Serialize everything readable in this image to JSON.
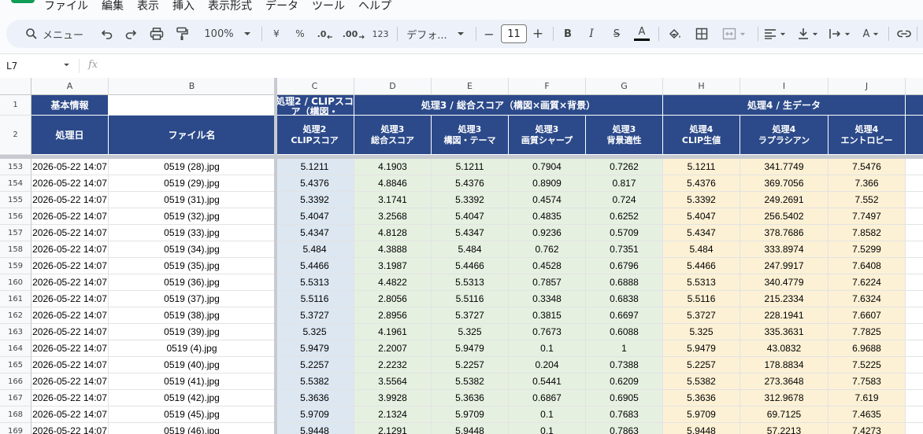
{
  "menu": [
    "ファイル",
    "編集",
    "表示",
    "挿入",
    "表示形式",
    "データ",
    "ツール",
    "ヘルプ"
  ],
  "toolbar": {
    "search_label": "メニュー",
    "zoom": "100%",
    "currency": "¥",
    "percent": "%",
    "dec_decrease": ".0",
    "dec_increase": ".00",
    "number_format": "123",
    "font": "デフォ...",
    "font_size": "11",
    "minus": "−",
    "plus": "+",
    "bold": "B",
    "italic": "I",
    "strike": "S",
    "text_color": "A"
  },
  "formula_bar": {
    "name_box": "L7",
    "fx": "fx"
  },
  "columns": [
    "A",
    "B",
    "C",
    "D",
    "E",
    "F",
    "G",
    "H",
    "I",
    "J"
  ],
  "header_row1": {
    "row_no": "1",
    "a": "基本情報",
    "c": "処理2 / CLIPスコア（構図・",
    "defg": "処理3 / 総合スコア（構図×画質×背景）",
    "hij": "処理4 / 生データ"
  },
  "header_row2": {
    "row_no": "2",
    "cells": [
      [
        "処理日"
      ],
      [
        "ファイル名"
      ],
      [
        "処理2",
        "CLIPスコア"
      ],
      [
        "処理3",
        "総合スコア"
      ],
      [
        "処理3",
        "構図・テーマ"
      ],
      [
        "処理3",
        "画質シャープ"
      ],
      [
        "処理3",
        "背景適性"
      ],
      [
        "処理4",
        "CLIP生値"
      ],
      [
        "処理4",
        "ラプラシアン"
      ],
      [
        "処理4",
        "エントロピー"
      ]
    ]
  },
  "colors": {
    "header_blue": "#2c4a8a",
    "col_c": "#dde7f1",
    "col_defg": "#e6f0e1",
    "col_hij": "#fdf1d5"
  },
  "rows": [
    {
      "n": "153",
      "date": "2026-05-22 14:07",
      "file": "0519 (28).jpg",
      "c": "5.1211",
      "d": "4.1903",
      "e": "5.1211",
      "f": "0.7904",
      "g": "0.7262",
      "h": "5.1211",
      "i": "341.7749",
      "j": "7.5476"
    },
    {
      "n": "154",
      "date": "2026-05-22 14:07",
      "file": "0519 (29).jpg",
      "c": "5.4376",
      "d": "4.8846",
      "e": "5.4376",
      "f": "0.8909",
      "g": "0.817",
      "h": "5.4376",
      "i": "369.7056",
      "j": "7.366"
    },
    {
      "n": "155",
      "date": "2026-05-22 14:07",
      "file": "0519 (31).jpg",
      "c": "5.3392",
      "d": "3.1741",
      "e": "5.3392",
      "f": "0.4574",
      "g": "0.724",
      "h": "5.3392",
      "i": "249.2691",
      "j": "7.552"
    },
    {
      "n": "156",
      "date": "2026-05-22 14:07",
      "file": "0519 (32).jpg",
      "c": "5.4047",
      "d": "3.2568",
      "e": "5.4047",
      "f": "0.4835",
      "g": "0.6252",
      "h": "5.4047",
      "i": "256.5402",
      "j": "7.7497"
    },
    {
      "n": "157",
      "date": "2026-05-22 14:07",
      "file": "0519 (33).jpg",
      "c": "5.4347",
      "d": "4.8128",
      "e": "5.4347",
      "f": "0.9236",
      "g": "0.5709",
      "h": "5.4347",
      "i": "378.7686",
      "j": "7.8582"
    },
    {
      "n": "158",
      "date": "2026-05-22 14:07",
      "file": "0519 (34).jpg",
      "c": "5.484",
      "d": "4.3888",
      "e": "5.484",
      "f": "0.762",
      "g": "0.7351",
      "h": "5.484",
      "i": "333.8974",
      "j": "7.5299"
    },
    {
      "n": "159",
      "date": "2026-05-22 14:07",
      "file": "0519 (35).jpg",
      "c": "5.4466",
      "d": "3.1987",
      "e": "5.4466",
      "f": "0.4528",
      "g": "0.6796",
      "h": "5.4466",
      "i": "247.9917",
      "j": "7.6408"
    },
    {
      "n": "160",
      "date": "2026-05-22 14:07",
      "file": "0519 (36).jpg",
      "c": "5.5313",
      "d": "4.4822",
      "e": "5.5313",
      "f": "0.7857",
      "g": "0.6888",
      "h": "5.5313",
      "i": "340.4779",
      "j": "7.6224"
    },
    {
      "n": "161",
      "date": "2026-05-22 14:07",
      "file": "0519 (37).jpg",
      "c": "5.5116",
      "d": "2.8056",
      "e": "5.5116",
      "f": "0.3348",
      "g": "0.6838",
      "h": "5.5116",
      "i": "215.2334",
      "j": "7.6324"
    },
    {
      "n": "162",
      "date": "2026-05-22 14:07",
      "file": "0519 (38).jpg",
      "c": "5.3727",
      "d": "2.8956",
      "e": "5.3727",
      "f": "0.3815",
      "g": "0.6697",
      "h": "5.3727",
      "i": "228.1941",
      "j": "7.6607"
    },
    {
      "n": "163",
      "date": "2026-05-22 14:07",
      "file": "0519 (39).jpg",
      "c": "5.325",
      "d": "4.1961",
      "e": "5.325",
      "f": "0.7673",
      "g": "0.6088",
      "h": "5.325",
      "i": "335.3631",
      "j": "7.7825"
    },
    {
      "n": "164",
      "date": "2026-05-22 14:07",
      "file": "0519 (4).jpg",
      "c": "5.9479",
      "d": "2.2007",
      "e": "5.9479",
      "f": "0.1",
      "g": "1",
      "h": "5.9479",
      "i": "43.0832",
      "j": "6.9688"
    },
    {
      "n": "165",
      "date": "2026-05-22 14:07",
      "file": "0519 (40).jpg",
      "c": "5.2257",
      "d": "2.2232",
      "e": "5.2257",
      "f": "0.204",
      "g": "0.7388",
      "h": "5.2257",
      "i": "178.8834",
      "j": "7.5225"
    },
    {
      "n": "166",
      "date": "2026-05-22 14:07",
      "file": "0519 (41).jpg",
      "c": "5.5382",
      "d": "3.5564",
      "e": "5.5382",
      "f": "0.5441",
      "g": "0.6209",
      "h": "5.5382",
      "i": "273.3648",
      "j": "7.7583"
    },
    {
      "n": "167",
      "date": "2026-05-22 14:07",
      "file": "0519 (42).jpg",
      "c": "5.3636",
      "d": "3.9928",
      "e": "5.3636",
      "f": "0.6867",
      "g": "0.6905",
      "h": "5.3636",
      "i": "312.9678",
      "j": "7.619"
    },
    {
      "n": "168",
      "date": "2026-05-22 14:07",
      "file": "0519 (45).jpg",
      "c": "5.9709",
      "d": "2.1324",
      "e": "5.9709",
      "f": "0.1",
      "g": "0.7683",
      "h": "5.9709",
      "i": "69.7125",
      "j": "7.4635"
    },
    {
      "n": "169",
      "date": "2026-05-22 14:07",
      "file": "0519 (46).jpg",
      "c": "5.9448",
      "d": "2.1291",
      "e": "5.9448",
      "f": "0.1",
      "g": "0.7863",
      "h": "5.9448",
      "i": "57.2213",
      "j": "7.4273"
    }
  ]
}
